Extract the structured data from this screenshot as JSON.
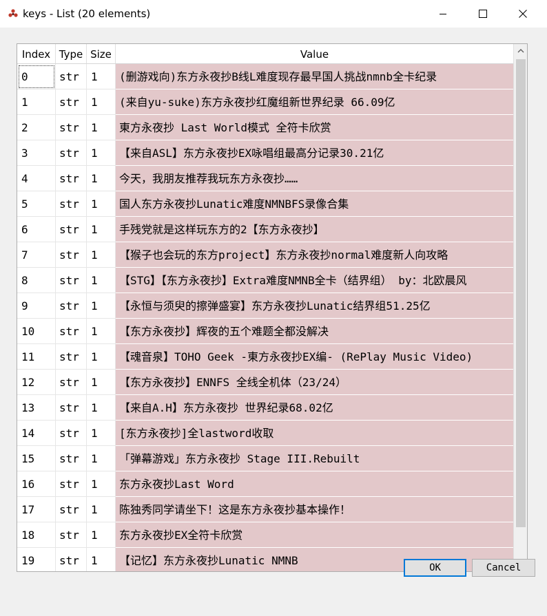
{
  "window": {
    "title": "keys - List (20 elements)",
    "icon": "red-dots-app-icon",
    "controls": [
      "minimize-icon",
      "maximize-icon",
      "close-icon"
    ]
  },
  "table": {
    "columns": [
      "Index",
      "Type",
      "Size",
      "Value"
    ],
    "sorted_column": "Index",
    "value_background": "#e3c8ca",
    "rows": [
      {
        "index": "0",
        "type": "str",
        "size": "1",
        "value": "(删游戏向)东方永夜抄B线L难度现存最早国人挑战nmnb全卡纪录"
      },
      {
        "index": "1",
        "type": "str",
        "size": "1",
        "value": "(来自yu-suke)东方永夜抄红魔组新世界纪录 66.09亿"
      },
      {
        "index": "2",
        "type": "str",
        "size": "1",
        "value": "東方永夜抄 Last World模式 全符卡欣赏"
      },
      {
        "index": "3",
        "type": "str",
        "size": "1",
        "value": "【来自ASL】东方永夜抄EX咏唱组最高分记录30.21亿"
      },
      {
        "index": "4",
        "type": "str",
        "size": "1",
        "value": "今天，我朋友推荐我玩东方永夜抄……"
      },
      {
        "index": "5",
        "type": "str",
        "size": "1",
        "value": "国人东方永夜抄Lunatic难度NMNBFS录像合集"
      },
      {
        "index": "6",
        "type": "str",
        "size": "1",
        "value": "手残党就是这样玩东方的2【东方永夜抄】"
      },
      {
        "index": "7",
        "type": "str",
        "size": "1",
        "value": "【猴子也会玩的东方project】东方永夜抄normal难度新人向攻略"
      },
      {
        "index": "8",
        "type": "str",
        "size": "1",
        "value": "【STG】【东方永夜抄】Extra难度NMNB全卡（结界组） by：北欧晨风"
      },
      {
        "index": "9",
        "type": "str",
        "size": "1",
        "value": "【永恒与须臾的擦弹盛宴】东方永夜抄Lunatic结界组51.25亿"
      },
      {
        "index": "10",
        "type": "str",
        "size": "1",
        "value": "【东方永夜抄】辉夜的五个难题全都没解决"
      },
      {
        "index": "11",
        "type": "str",
        "size": "1",
        "value": "【魂音泉】TOHO Geek -東方永夜抄EX编- (RePlay Music Video)"
      },
      {
        "index": "12",
        "type": "str",
        "size": "1",
        "value": "【东方永夜抄】ENNFS 全线全机体（23/24）"
      },
      {
        "index": "13",
        "type": "str",
        "size": "1",
        "value": "【来自A.H】东方永夜抄 世界纪录68.02亿"
      },
      {
        "index": "14",
        "type": "str",
        "size": "1",
        "value": "[东方永夜抄]全lastword收取"
      },
      {
        "index": "15",
        "type": "str",
        "size": "1",
        "value": "「弹幕游戏」东方永夜抄 Stage III.Rebuilt"
      },
      {
        "index": "16",
        "type": "str",
        "size": "1",
        "value": "东方永夜抄Last Word"
      },
      {
        "index": "17",
        "type": "str",
        "size": "1",
        "value": "陈独秀同学请坐下！这是东方永夜抄基本操作！"
      },
      {
        "index": "18",
        "type": "str",
        "size": "1",
        "value": "东方永夜抄EX全符卡欣赏"
      },
      {
        "index": "19",
        "type": "str",
        "size": "1",
        "value": "【记忆】东方永夜抄Lunatic NMNB"
      }
    ]
  },
  "buttons": {
    "ok": "OK",
    "cancel": "Cancel"
  }
}
